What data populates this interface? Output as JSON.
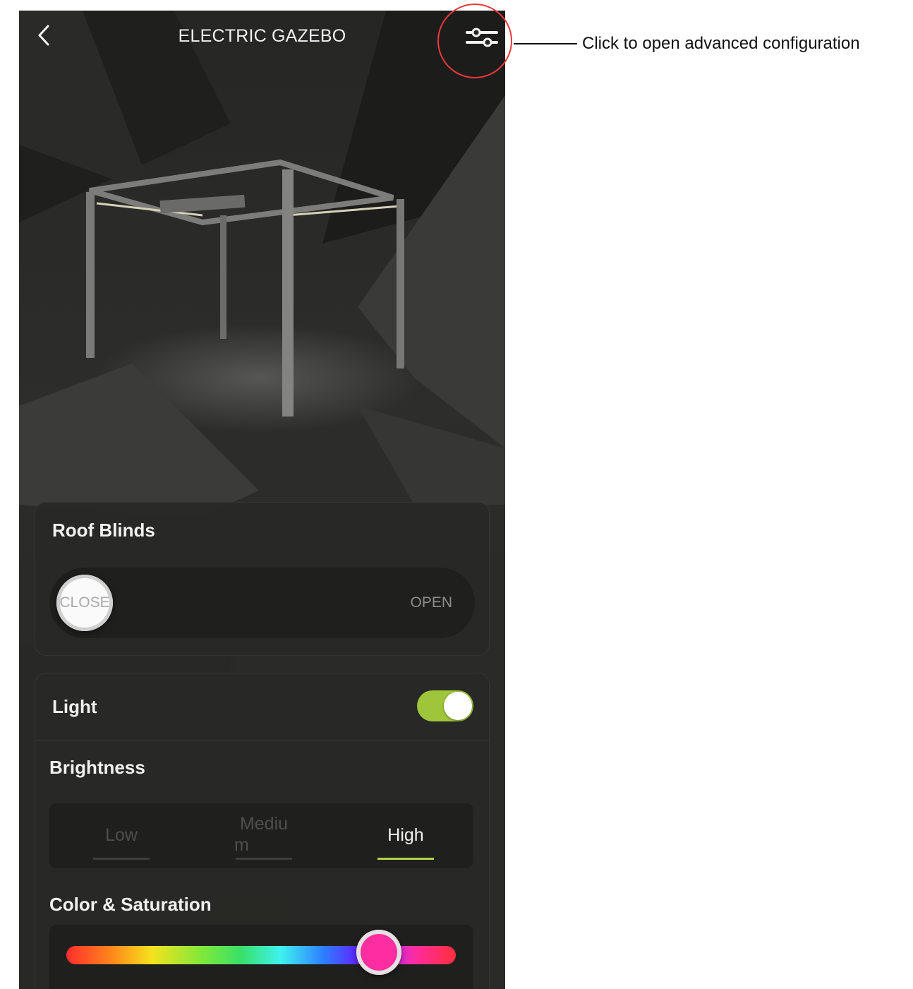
{
  "app": {
    "title": "ELECTRIC GAZEBO",
    "back_icon": "chevron-left-icon",
    "settings_icon": "sliders-icon"
  },
  "roof_blinds": {
    "title": "Roof Blinds",
    "close_label": "CLOSE",
    "open_label": "OPEN",
    "position": 0
  },
  "light": {
    "title": "Light",
    "enabled": true,
    "toggle_color": "#9fc63b",
    "brightness": {
      "title": "Brightness",
      "options": [
        {
          "line1": "Low",
          "line2": ""
        },
        {
          "line1": "Mediu",
          "line2": "m"
        },
        {
          "line1": "High",
          "line2": ""
        }
      ],
      "selected": "High",
      "accent": "#b0d444"
    },
    "color": {
      "title": "Color & Saturation",
      "hue_position": 0.85,
      "selected_color": "#ff2ea0"
    }
  },
  "annotation": {
    "text": "Click to open advanced configuration",
    "circle_color": "#e83a3a"
  }
}
